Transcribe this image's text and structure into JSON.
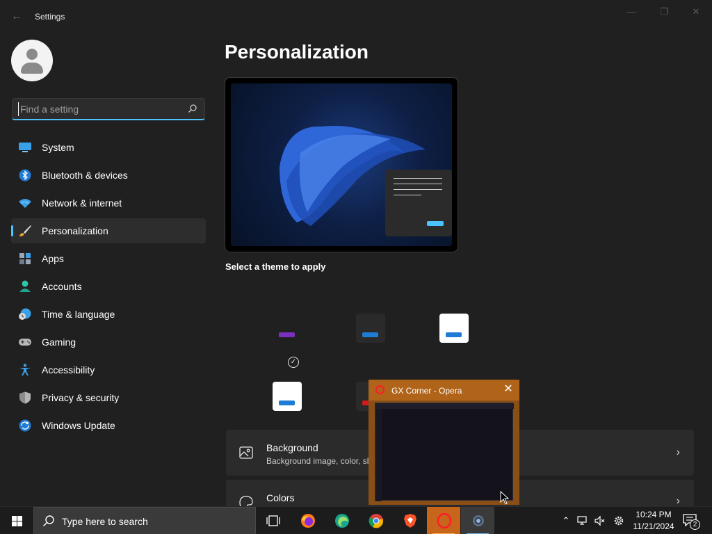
{
  "window": {
    "title": "Settings",
    "back_icon": "back-arrow-icon",
    "controls": [
      "minimize-icon",
      "restore-icon",
      "close-icon"
    ]
  },
  "sidebar": {
    "search": {
      "placeholder": "Find a setting",
      "value": ""
    },
    "items": [
      {
        "label": "System",
        "icon": "system-icon"
      },
      {
        "label": "Bluetooth & devices",
        "icon": "bluetooth-icon"
      },
      {
        "label": "Network & internet",
        "icon": "wifi-icon"
      },
      {
        "label": "Personalization",
        "icon": "paintbrush-icon",
        "selected": true
      },
      {
        "label": "Apps",
        "icon": "apps-icon"
      },
      {
        "label": "Accounts",
        "icon": "account-icon"
      },
      {
        "label": "Time & language",
        "icon": "globe-clock-icon"
      },
      {
        "label": "Gaming",
        "icon": "gamepad-icon"
      },
      {
        "label": "Accessibility",
        "icon": "accessibility-icon"
      },
      {
        "label": "Privacy & security",
        "icon": "shield-icon"
      },
      {
        "label": "Windows Update",
        "icon": "update-icon"
      }
    ]
  },
  "main": {
    "title": "Personalization",
    "theme_section_label": "Select a theme to apply",
    "themes": [
      {
        "name": "theme-1",
        "bg": "#202020",
        "bar": "#7b2fbf"
      },
      {
        "name": "theme-2",
        "bg": "#2a2a2a",
        "bar": "#1f7cd6"
      },
      {
        "name": "theme-3",
        "bg": "#ffffff",
        "bar": "#1f7cd6"
      },
      {
        "name": "theme-4",
        "bg": "#ffffff",
        "bar": "#1f7cd6"
      },
      {
        "name": "theme-5",
        "bg": "#2a2a2a",
        "bar": "#d11a1a"
      }
    ],
    "cards": [
      {
        "title": "Background",
        "subtitle": "Background image, color, sl",
        "icon": "image-icon"
      },
      {
        "title": "Colors",
        "subtitle": "",
        "icon": "palette-icon"
      }
    ]
  },
  "thumbnail_popup": {
    "title": "GX Corner - Opera"
  },
  "taskbar": {
    "search_label": "Type here to search",
    "apps": [
      "task-view-icon",
      "firefox-icon",
      "edge-icon",
      "chrome-icon",
      "brave-icon",
      "opera-icon",
      "settings-icon"
    ],
    "tray_icons": [
      "chevron-up-icon",
      "network-icon",
      "volume-muted-icon",
      "gear-icon"
    ],
    "clock": {
      "time": "10:24 PM",
      "date": "11/21/2024"
    },
    "notifications": {
      "count": "2"
    }
  },
  "colors": {
    "accent": "#4cc2ff",
    "background": "#202020",
    "card": "#2b2b2b"
  }
}
